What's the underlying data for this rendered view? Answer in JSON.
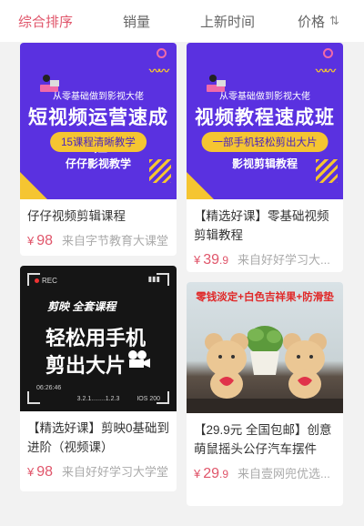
{
  "sort_bar": {
    "items": [
      "综合排序",
      "销量",
      "上新时间",
      "价格"
    ],
    "active_index": 0,
    "price_icon": "sort-arrows-icon"
  },
  "products": [
    {
      "title": "仔仔视频剪辑课程",
      "price": "98",
      "source": "来自字节教育大课堂",
      "thumb": {
        "subtitle": "从零基础做到影视大佬",
        "headline": "短视频运营速成班",
        "pill": "15课程清晰教学",
        "tag": "仔仔影视教学"
      }
    },
    {
      "title": "【精选好课】零基础视频剪辑教程",
      "price_int": "39",
      "price_dec": ".9",
      "source": "来自好好学习大...",
      "thumb": {
        "subtitle": "从零基础做到影视大佬",
        "headline": "视频教程速成班",
        "pill": "一部手机轻松剪出大片",
        "tag": "影视剪辑教程"
      }
    },
    {
      "title": "【精选好课】剪映0基础到进阶（视频课）",
      "price": "98",
      "source": "来自好好学习大学堂",
      "thumb": {
        "rec": "REC",
        "brand": "剪映 全套课程",
        "line1": "轻松用手机",
        "line2": "剪出大片",
        "time": "06:26:46",
        "frames": "3.2.1........1.2.3",
        "iso": "IOS 200"
      }
    },
    {
      "title": "【29.9元 全国包邮】创意萌鼠摇头公仔汽车摆件P0...",
      "price_int": "29",
      "price_dec": ".9",
      "source": "来自壹网兜优选...",
      "thumb": {
        "headline": "零钱淡定+白色吉祥果+防滑垫"
      }
    }
  ],
  "currency_symbol": "¥",
  "colors": {
    "accent": "#e0556a",
    "purple": "#5a31e0",
    "yellow": "#f5c531"
  }
}
